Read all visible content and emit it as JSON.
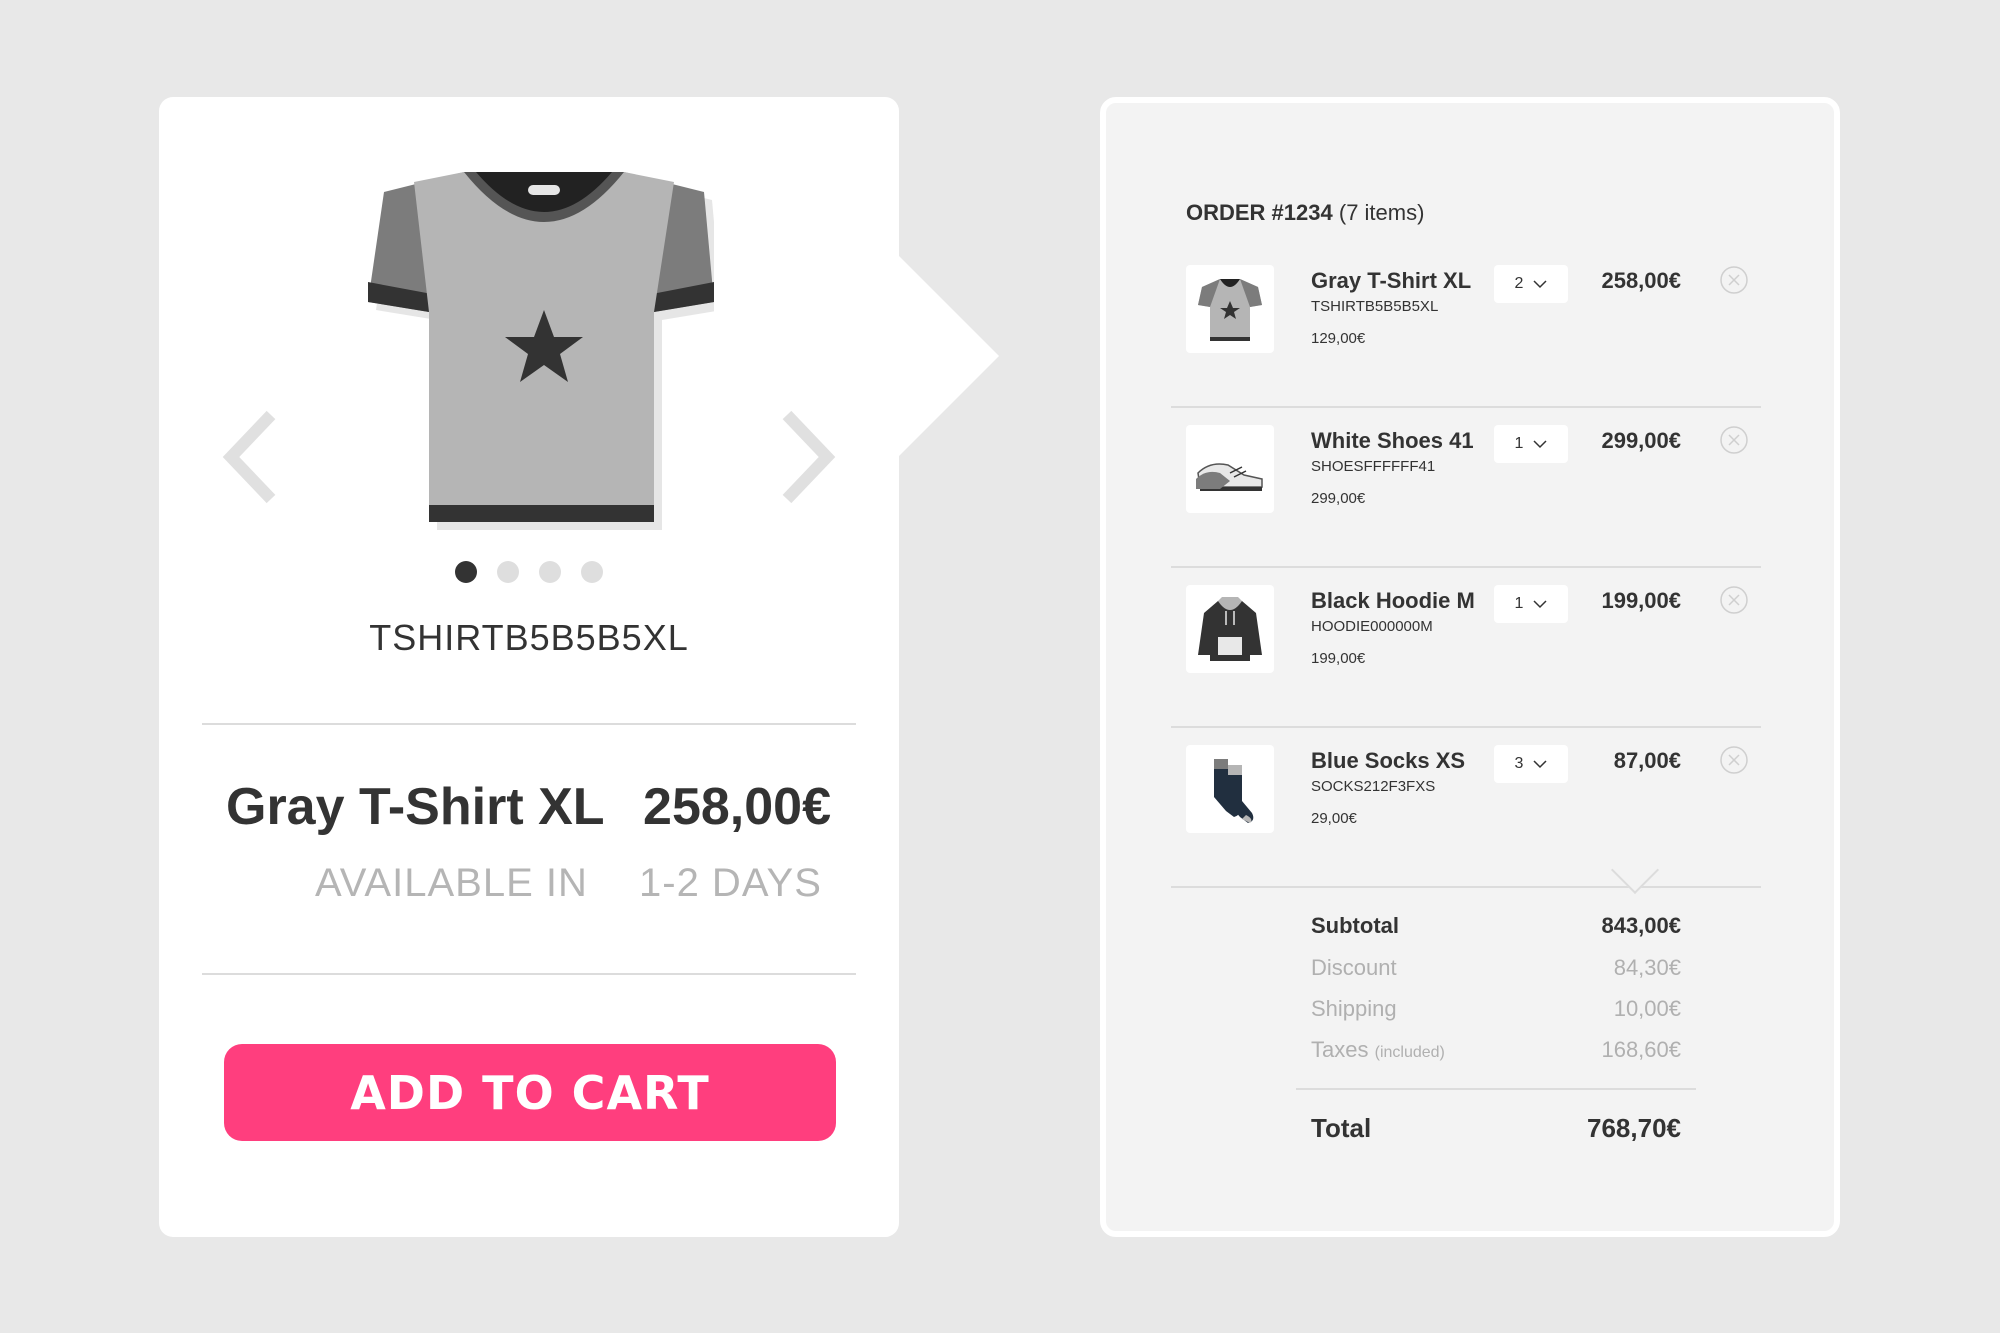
{
  "product": {
    "sku": "TSHIRTB5B5B5XL",
    "name": "Gray T-Shirt XL",
    "price": "258,00€",
    "availability_label": "AVAILABLE IN",
    "availability_value": "1-2 DAYS",
    "add_to_cart_label": "ADD TO CART",
    "carousel": {
      "slides": 4,
      "active_index": 0
    },
    "accent_color": "#ff3e7e"
  },
  "order": {
    "title_bold": "ORDER #1234",
    "title_suffix": "(7 items)",
    "items": [
      {
        "name": "Gray T-Shirt XL",
        "sku": "TSHIRTB5B5B5XL",
        "unit_price": "129,00€",
        "qty": "2",
        "total": "258,00€",
        "icon": "tshirt-icon"
      },
      {
        "name": "White Shoes 41",
        "sku": "SHOESFFFFFF41",
        "unit_price": "299,00€",
        "qty": "1",
        "total": "299,00€",
        "icon": "shoes-icon"
      },
      {
        "name": "Black Hoodie M",
        "sku": "HOODIE000000M",
        "unit_price": "199,00€",
        "qty": "1",
        "total": "199,00€",
        "icon": "hoodie-icon"
      },
      {
        "name": "Blue Socks XS",
        "sku": "SOCKS212F3FXS",
        "unit_price": "29,00€",
        "qty": "3",
        "total": "87,00€",
        "icon": "socks-icon"
      }
    ],
    "summary": {
      "subtotal_label": "Subtotal",
      "subtotal": "843,00€",
      "discount_label": "Discount",
      "discount": "84,30€",
      "shipping_label": "Shipping",
      "shipping": "10,00€",
      "taxes_label": "Taxes",
      "taxes_note": "(included)",
      "taxes": "168,60€",
      "total_label": "Total",
      "total": "768,70€"
    }
  }
}
